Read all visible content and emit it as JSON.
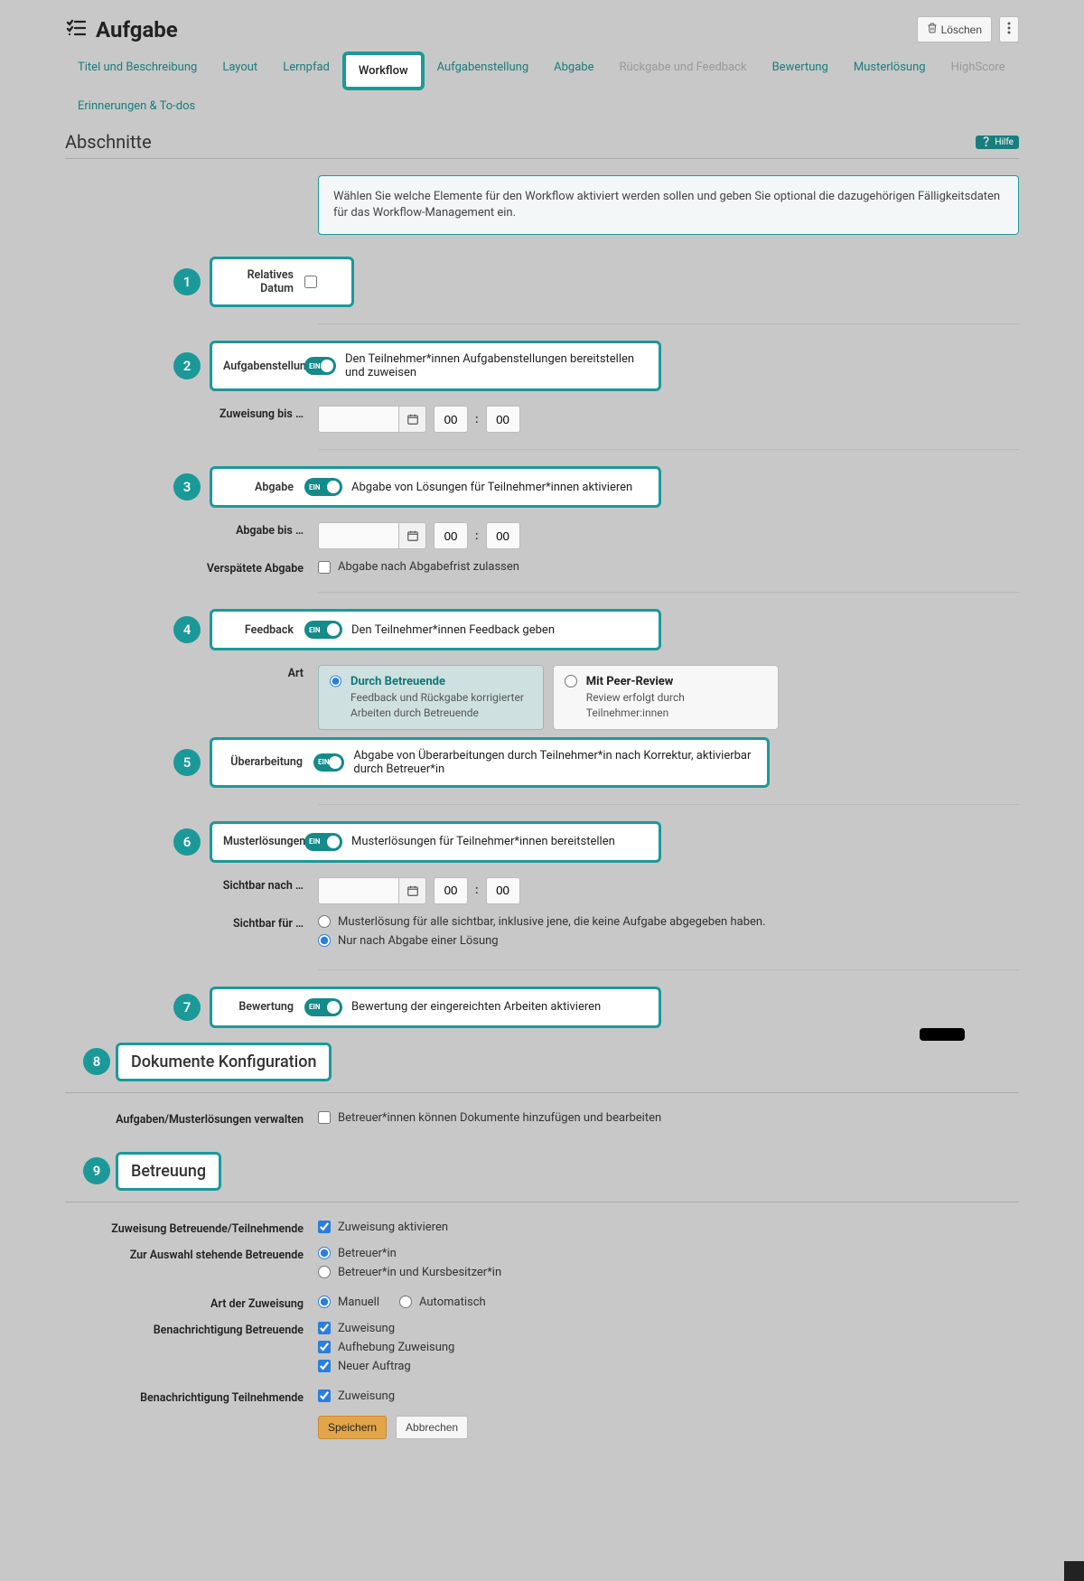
{
  "header": {
    "title": "Aufgabe",
    "delete_label": "Löschen"
  },
  "tabs": {
    "items": [
      {
        "label": "Titel und Beschreibung",
        "mode": "link"
      },
      {
        "label": "Layout",
        "mode": "link"
      },
      {
        "label": "Lernpfad",
        "mode": "link"
      },
      {
        "label": "Workflow",
        "mode": "active"
      },
      {
        "label": "Aufgabenstellung",
        "mode": "link"
      },
      {
        "label": "Abgabe",
        "mode": "link"
      },
      {
        "label": "Rückgabe und Feedback",
        "mode": "muted"
      },
      {
        "label": "Bewertung",
        "mode": "link"
      },
      {
        "label": "Musterlösung",
        "mode": "link"
      },
      {
        "label": "HighScore",
        "mode": "muted"
      },
      {
        "label": "Erinnerungen & To-dos",
        "mode": "link"
      }
    ]
  },
  "section": {
    "title": "Abschnitte",
    "help": "Hilfe"
  },
  "info": "Wählen Sie welche Elemente für den Workflow aktiviert werden sollen und geben Sie optional die dazugehörigen Fälligkeitsdaten für das Workflow-Management ein.",
  "steps": {
    "s1": {
      "num": "1",
      "label": "Relatives Datum"
    },
    "s2": {
      "num": "2",
      "label": "Aufgabenstellung",
      "toggle": "EIN",
      "desc": "Den Teilnehmer*innen Aufgabenstellungen bereitstellen und zuweisen",
      "assign_label": "Zuweisung bis …",
      "hh": "00",
      "mm": "00"
    },
    "s3": {
      "num": "3",
      "label": "Abgabe",
      "toggle": "EIN",
      "desc": "Abgabe von Lösungen für Teilnehmer*innen aktivieren",
      "deadline_label": "Abgabe bis …",
      "hh": "00",
      "mm": "00",
      "late_label": "Verspätete Abgabe",
      "late_desc": "Abgabe nach Abgabefrist zulassen"
    },
    "s4": {
      "num": "4",
      "label": "Feedback",
      "toggle": "EIN",
      "desc": "Den Teilnehmer*innen Feedback geben",
      "art_label": "Art",
      "card1_title": "Durch Betreuende",
      "card1_desc": "Feedback und Rückgabe korrigierter Arbeiten durch Betreuende",
      "card2_title": "Mit Peer-Review",
      "card2_desc": "Review erfolgt durch Teilnehmer:innen"
    },
    "s5": {
      "num": "5",
      "label": "Überarbeitung",
      "toggle": "EIN",
      "desc": "Abgabe von Überarbeitungen durch Teilnehmer*in nach Korrektur, aktivierbar durch Betreuer*in"
    },
    "s6": {
      "num": "6",
      "label": "Musterlösungen",
      "toggle": "EIN",
      "desc": "Musterlösungen für Teilnehmer*innen bereitstellen",
      "visible_after": "Sichtbar nach …",
      "hh": "00",
      "mm": "00",
      "visible_for": "Sichtbar für …",
      "opt1": "Musterlösung für alle sichtbar, inklusive jene, die keine Aufgabe abgegeben haben.",
      "opt2": "Nur nach Abgabe einer Lösung"
    },
    "s7": {
      "num": "7",
      "label": "Bewertung",
      "toggle": "EIN",
      "desc": "Bewertung der eingereichten Arbeiten aktivieren"
    },
    "s8": {
      "num": "8",
      "title": "Dokumente Konfiguration",
      "manage_label": "Aufgaben/Musterlösungen verwalten",
      "manage_desc": "Betreuer*innen können Dokumente hinzufügen und bearbeiten"
    },
    "s9": {
      "num": "9",
      "title": "Betreuung",
      "assign_label": "Zuweisung Betreuende/Teilnehmende",
      "assign_desc": "Zuweisung aktivieren",
      "avail_label": "Zur Auswahl stehende Betreuende",
      "avail_opt1": "Betreuer*in",
      "avail_opt2": "Betreuer*in und Kursbesitzer*in",
      "type_label": "Art der Zuweisung",
      "type_opt1": "Manuell",
      "type_opt2": "Automatisch",
      "notify_coach_label": "Benachrichtigung Betreuende",
      "nc1": "Zuweisung",
      "nc2": "Aufhebung Zuweisung",
      "nc3": "Neuer Auftrag",
      "notify_part_label": "Benachrichtigung Teilnehmende",
      "np1": "Zuweisung"
    }
  },
  "actions": {
    "save": "Speichern",
    "cancel": "Abbrechen"
  }
}
